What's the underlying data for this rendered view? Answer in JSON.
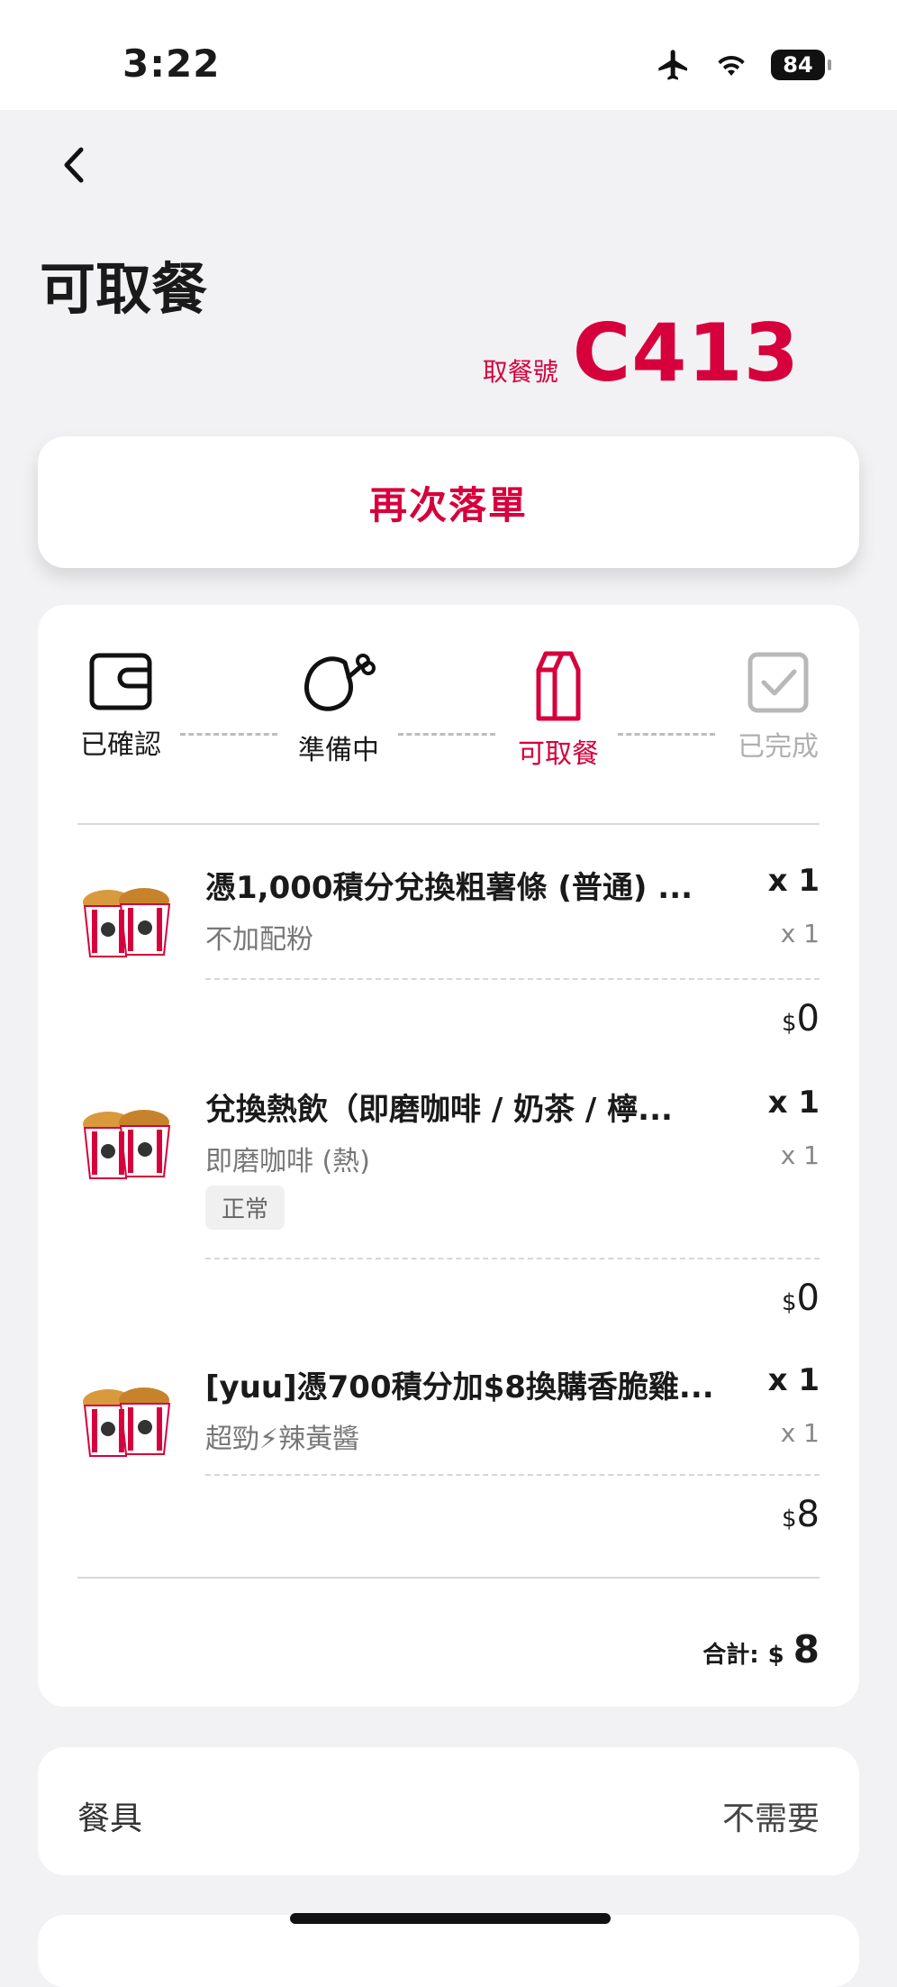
{
  "status_bar": {
    "time": "3:22",
    "battery": "84"
  },
  "page": {
    "title": "可取餐",
    "pickup_label": "取餐號",
    "pickup_number": "C413"
  },
  "reorder_label": "再次落單",
  "steps": [
    {
      "label": "已確認",
      "icon": "wallet-icon",
      "state": "done"
    },
    {
      "label": "準備中",
      "icon": "chicken-drumstick-icon",
      "state": "done"
    },
    {
      "label": "可取餐",
      "icon": "takeaway-bag-icon",
      "state": "active"
    },
    {
      "label": "已完成",
      "icon": "checkbox-icon",
      "state": "pending"
    }
  ],
  "items": [
    {
      "name": "憑1,000積分兌換粗薯條 (普通) ...",
      "qty": "x 1",
      "option": "不加配粉",
      "option_qty": "x 1",
      "tag": "",
      "currency": "$",
      "price": "0"
    },
    {
      "name": "兌換熱飲（即磨咖啡 / 奶茶 / 檸...",
      "qty": "x 1",
      "option": "即磨咖啡 (熱)",
      "option_qty": "x 1",
      "tag": "正常",
      "currency": "$",
      "price": "0"
    },
    {
      "name": "[yuu]憑700積分加$8換購香脆雞...",
      "qty": "x 1",
      "option": "超勁⚡辣黃醬",
      "option_qty": "x 1",
      "tag": "",
      "currency": "$",
      "price": "8"
    }
  ],
  "total": {
    "label": "合計:",
    "currency": "$",
    "value": "8"
  },
  "utensils": {
    "label": "餐具",
    "value": "不需要"
  },
  "colors": {
    "accent": "#d6003c",
    "background": "#f2f2f4",
    "card": "#ffffff"
  }
}
